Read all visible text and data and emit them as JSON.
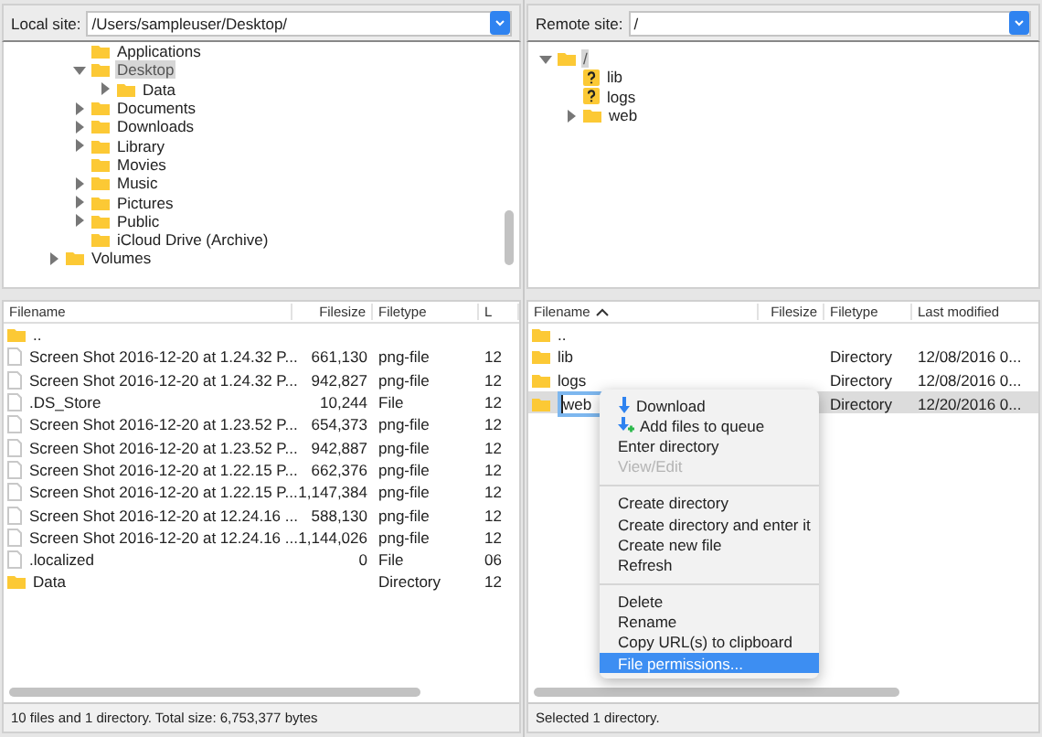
{
  "local": {
    "site_label": "Local site:",
    "site_path": "/Users/sampleuser/Desktop/",
    "tree": [
      {
        "children": [
          {
            "label": "Applications",
            "kind": "folder",
            "expandable": false,
            "selected": false
          },
          {
            "label": "Desktop",
            "kind": "folder",
            "expandable": true,
            "expanded": true,
            "selected": true,
            "children": [
              {
                "label": "Data",
                "kind": "folder",
                "expandable": true,
                "expanded": false,
                "selected": false
              }
            ]
          },
          {
            "label": "Documents",
            "kind": "folder",
            "expandable": true,
            "expanded": false,
            "selected": false
          },
          {
            "label": "Downloads",
            "kind": "folder",
            "expandable": true,
            "expanded": false,
            "selected": false
          },
          {
            "label": "Library",
            "kind": "folder",
            "expandable": true,
            "expanded": false,
            "selected": false
          },
          {
            "label": "Movies",
            "kind": "folder",
            "expandable": false,
            "selected": false
          },
          {
            "label": "Music",
            "kind": "folder",
            "expandable": true,
            "expanded": false,
            "selected": false
          },
          {
            "label": "Pictures",
            "kind": "folder",
            "expandable": true,
            "expanded": false,
            "selected": false
          },
          {
            "label": "Public",
            "kind": "folder",
            "expandable": true,
            "expanded": false,
            "selected": false
          },
          {
            "label": "iCloud Drive (Archive)",
            "kind": "folder",
            "expandable": false,
            "selected": false
          }
        ]
      },
      {
        "label": "Volumes",
        "kind": "folder",
        "expandable": true,
        "expanded": false,
        "selected": false
      }
    ],
    "columns": [
      {
        "label": "Filename",
        "sorted": false
      },
      {
        "label": "Filesize",
        "sorted": false
      },
      {
        "label": "Filetype",
        "sorted": false
      },
      {
        "label": "L",
        "sorted": false
      }
    ],
    "rows": [
      {
        "kind": "folder",
        "name": "..",
        "size": "",
        "type": "",
        "modified": "",
        "selected": false
      },
      {
        "kind": "file",
        "name": "Screen Shot 2016-12-20 at 1.24.32 P...",
        "size": "661,130",
        "type": "png-file",
        "modified": "12",
        "selected": false
      },
      {
        "kind": "file",
        "name": "Screen Shot 2016-12-20 at 1.24.32 P...",
        "size": "942,827",
        "type": "png-file",
        "modified": "12",
        "selected": false
      },
      {
        "kind": "file",
        "name": ".DS_Store",
        "size": "10,244",
        "type": "File",
        "modified": "12",
        "selected": false
      },
      {
        "kind": "file",
        "name": "Screen Shot 2016-12-20 at 1.23.52 P...",
        "size": "654,373",
        "type": "png-file",
        "modified": "12",
        "selected": false
      },
      {
        "kind": "file",
        "name": "Screen Shot 2016-12-20 at 1.23.52 P...",
        "size": "942,887",
        "type": "png-file",
        "modified": "12",
        "selected": false
      },
      {
        "kind": "file",
        "name": "Screen Shot 2016-12-20 at 1.22.15 P...",
        "size": "662,376",
        "type": "png-file",
        "modified": "12",
        "selected": false
      },
      {
        "kind": "file",
        "name": "Screen Shot 2016-12-20 at 1.22.15 P...",
        "size": "1,147,384",
        "type": "png-file",
        "modified": "12",
        "selected": false
      },
      {
        "kind": "file",
        "name": "Screen Shot 2016-12-20 at 12.24.16 ...",
        "size": "588,130",
        "type": "png-file",
        "modified": "12",
        "selected": false
      },
      {
        "kind": "file",
        "name": "Screen Shot 2016-12-20 at 12.24.16 ...",
        "size": "1,144,026",
        "type": "png-file",
        "modified": "12",
        "selected": false
      },
      {
        "kind": "file",
        "name": ".localized",
        "size": "0",
        "type": "File",
        "modified": "06",
        "selected": false
      },
      {
        "kind": "folder",
        "name": "Data",
        "size": "",
        "type": "Directory",
        "modified": "12",
        "selected": false
      }
    ],
    "status": "10 files and 1 directory. Total size: 6,753,377 bytes"
  },
  "remote": {
    "site_label": "Remote site:",
    "site_path": "/",
    "tree": [
      {
        "label": "/",
        "kind": "folder",
        "expandable": true,
        "expanded": true,
        "selected": true,
        "children": [
          {
            "label": "lib",
            "kind": "unknown",
            "expandable": false,
            "selected": false
          },
          {
            "label": "logs",
            "kind": "unknown",
            "expandable": false,
            "selected": false
          },
          {
            "label": "web",
            "kind": "folder",
            "expandable": true,
            "expanded": false,
            "selected": false
          }
        ]
      }
    ],
    "columns": [
      {
        "label": "Filename",
        "sorted": true
      },
      {
        "label": "Filesize",
        "sorted": false
      },
      {
        "label": "Filetype",
        "sorted": false
      },
      {
        "label": "Last modified",
        "sorted": false
      }
    ],
    "rows": [
      {
        "kind": "folder",
        "name": "..",
        "size": "",
        "type": "",
        "modified": "",
        "selected": false,
        "editing": false
      },
      {
        "kind": "folder",
        "name": "lib",
        "size": "",
        "type": "Directory",
        "modified": "12/08/2016 0...",
        "selected": false,
        "editing": false
      },
      {
        "kind": "folder",
        "name": "logs",
        "size": "",
        "type": "Directory",
        "modified": "12/08/2016 0...",
        "selected": false,
        "editing": false
      },
      {
        "kind": "folder",
        "name": "web",
        "size": "",
        "type": "Directory",
        "modified": "12/20/2016 0...",
        "selected": true,
        "editing": true
      }
    ],
    "status": "Selected 1 directory.",
    "context_menu": [
      {
        "kind": "download",
        "label": "Download",
        "disabled": false,
        "selected": false
      },
      {
        "kind": "queue",
        "label": "Add files to queue",
        "disabled": false,
        "selected": false
      },
      {
        "kind": "item",
        "label": "Enter directory",
        "disabled": false,
        "selected": false
      },
      {
        "kind": "item",
        "label": "View/Edit",
        "disabled": true,
        "selected": false
      },
      {
        "kind": "separator"
      },
      {
        "kind": "item",
        "label": "Create directory",
        "disabled": false,
        "selected": false
      },
      {
        "kind": "item",
        "label": "Create directory and enter it",
        "disabled": false,
        "selected": false
      },
      {
        "kind": "item",
        "label": "Create new file",
        "disabled": false,
        "selected": false
      },
      {
        "kind": "item",
        "label": "Refresh",
        "disabled": false,
        "selected": false
      },
      {
        "kind": "separator"
      },
      {
        "kind": "item",
        "label": "Delete",
        "disabled": false,
        "selected": false
      },
      {
        "kind": "item",
        "label": "Rename",
        "disabled": false,
        "selected": false
      },
      {
        "kind": "item",
        "label": "Copy URL(s) to clipboard",
        "disabled": false,
        "selected": false
      },
      {
        "kind": "item",
        "label": "File permissions...",
        "disabled": false,
        "selected": true
      }
    ]
  }
}
